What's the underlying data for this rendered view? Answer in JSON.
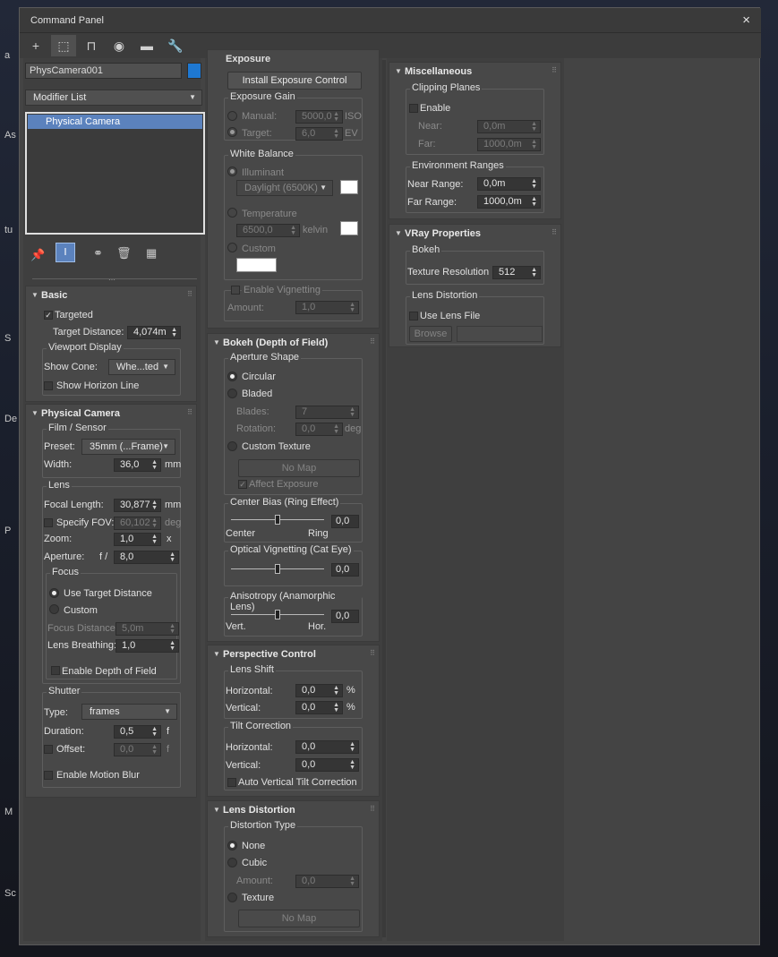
{
  "background_labels": [
    "a",
    "As",
    "tu",
    "S",
    "De",
    "P",
    "M",
    "Sc"
  ],
  "window": {
    "title": "Command Panel",
    "close": "×"
  },
  "tabs": [
    {
      "name": "create-tab",
      "glyph": "+"
    },
    {
      "name": "modify-tab",
      "glyph": "⬚"
    },
    {
      "name": "hierarchy-tab",
      "glyph": "⊓"
    },
    {
      "name": "motion-tab",
      "glyph": "◉"
    },
    {
      "name": "display-tab",
      "glyph": "▬"
    },
    {
      "name": "utilities-tab",
      "glyph": "🔧"
    }
  ],
  "object": {
    "name": "PhysCamera001",
    "color": "#1e78d2",
    "modifier_list": "Modifier List",
    "stack": [
      "Physical Camera"
    ]
  },
  "basic": {
    "title": "Basic",
    "targeted": "Targeted",
    "target_distance_label": "Target Distance:",
    "target_distance": "4,074m",
    "viewport_display": "Viewport Display",
    "show_cone_label": "Show Cone:",
    "show_cone": "Whe...ted",
    "show_horizon": "Show Horizon Line"
  },
  "physical_camera": {
    "title": "Physical Camera",
    "film_sensor": "Film / Sensor",
    "preset_label": "Preset:",
    "preset": "35mm (...Frame)",
    "width_label": "Width:",
    "width": "36,0",
    "width_unit": "mm",
    "lens": "Lens",
    "focal_length_label": "Focal Length:",
    "focal_length": "30,877",
    "focal_unit": "mm",
    "specify_fov": "Specify FOV:",
    "fov": "60,102",
    "fov_unit": "deg",
    "zoom_label": "Zoom:",
    "zoom": "1,0",
    "zoom_unit": "x",
    "aperture_label": "Aperture:",
    "aperture_f": "f /",
    "aperture": "8,0",
    "focus": "Focus",
    "use_target_distance": "Use Target Distance",
    "custom": "Custom",
    "focus_distance_label": "Focus Distance:",
    "focus_distance": "5,0m",
    "lens_breathing_label": "Lens Breathing:",
    "lens_breathing": "1,0",
    "enable_dof": "Enable Depth of Field",
    "shutter": "Shutter",
    "type_label": "Type:",
    "type": "frames",
    "duration_label": "Duration:",
    "duration": "0,5",
    "duration_unit": "f",
    "offset_label": "Offset:",
    "offset": "0,0",
    "offset_unit": "f",
    "enable_motion_blur": "Enable Motion Blur"
  },
  "exposure": {
    "title": "Exposure",
    "install_button": "Install Exposure Control",
    "exposure_gain": "Exposure Gain",
    "manual_label": "Manual:",
    "manual": "5000,0",
    "manual_unit": "ISO",
    "target_label": "Target:",
    "target": "6,0",
    "target_unit": "EV",
    "white_balance": "White Balance",
    "illuminant": "Illuminant",
    "illuminant_value": "Daylight (6500K)",
    "temperature": "Temperature",
    "temperature_value": "6500,0",
    "temperature_unit": "kelvin",
    "custom": "Custom",
    "enable_vignetting": "Enable Vignetting",
    "amount_label": "Amount:",
    "amount": "1,0"
  },
  "bokeh": {
    "title": "Bokeh (Depth of Field)",
    "aperture_shape": "Aperture Shape",
    "circular": "Circular",
    "bladed": "Bladed",
    "blades_label": "Blades:",
    "blades": "7",
    "rotation_label": "Rotation:",
    "rotation": "0,0",
    "rotation_unit": "deg",
    "custom_texture": "Custom Texture",
    "no_map": "No Map",
    "affect_exposure": "Affect Exposure",
    "center_bias": "Center Bias (Ring Effect)",
    "center_bias_value": "0,0",
    "center_bias_fraction": 0.5,
    "center": "Center",
    "ring": "Ring",
    "optical_vignetting": "Optical Vignetting (Cat Eye)",
    "optical_vignetting_value": "0,0",
    "optical_vignetting_fraction": 0.5,
    "anisotropy": "Anisotropy (Anamorphic Lens)",
    "anisotropy_value": "0,0",
    "anisotropy_fraction": 0.5,
    "vert": "Vert.",
    "hor": "Hor."
  },
  "perspective": {
    "title": "Perspective Control",
    "lens_shift": "Lens Shift",
    "horizontal_label": "Horizontal:",
    "h_shift": "0,0",
    "h_unit": "%",
    "vertical_label": "Vertical:",
    "v_shift": "0,0",
    "v_unit": "%",
    "tilt_correction": "Tilt Correction",
    "h_tilt": "0,0",
    "v_tilt": "0,0",
    "auto_vertical": "Auto Vertical Tilt Correction"
  },
  "lens_distortion": {
    "title": "Lens Distortion",
    "distortion_type": "Distortion Type",
    "none": "None",
    "cubic": "Cubic",
    "amount_label": "Amount:",
    "amount": "0,0",
    "texture": "Texture",
    "no_map": "No Map"
  },
  "misc": {
    "title": "Miscellaneous",
    "clipping_planes": "Clipping Planes",
    "enable": "Enable",
    "near_label": "Near:",
    "near": "0,0m",
    "far_label": "Far:",
    "far": "1000,0m",
    "environment_ranges": "Environment Ranges",
    "near_range_label": "Near Range:",
    "near_range": "0,0m",
    "far_range_label": "Far Range:",
    "far_range": "1000,0m"
  },
  "vray": {
    "title": "VRay Properties",
    "bokeh": "Bokeh",
    "texture_resolution_label": "Texture Resolution",
    "texture_resolution": "512",
    "lens_distortion": "Lens Distortion",
    "use_lens_file": "Use Lens File",
    "browse": "Browse"
  }
}
